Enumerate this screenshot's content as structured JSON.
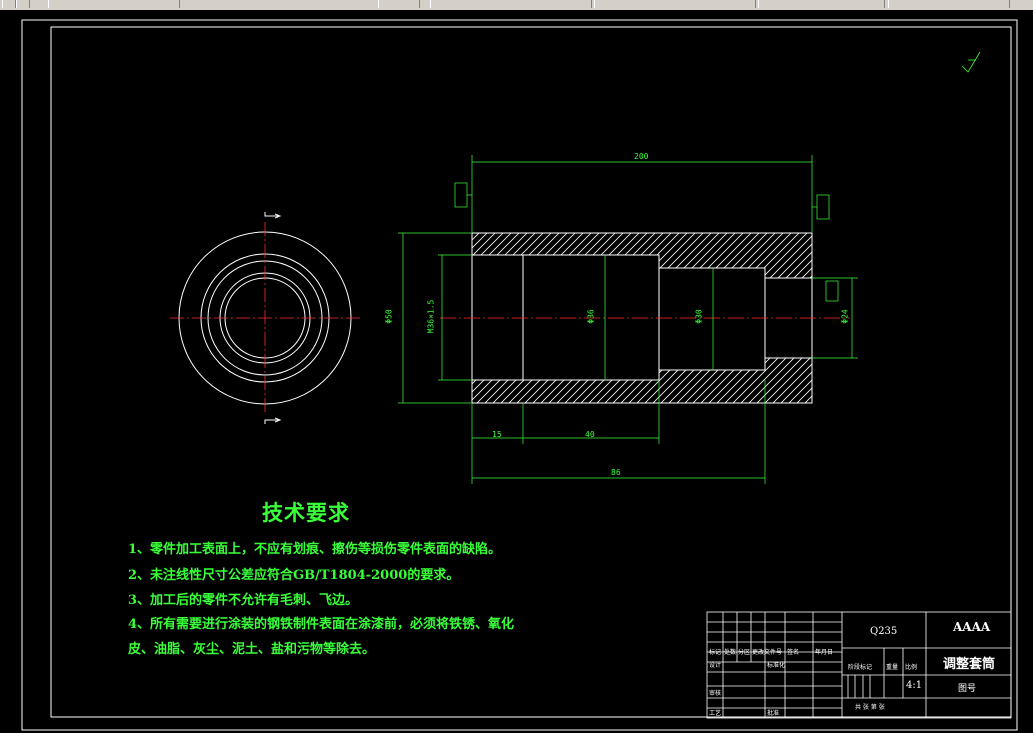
{
  "dimensions": {
    "overall_length": "200",
    "bottom_total": "86",
    "seg_15": "15",
    "seg_40": "40",
    "phi_outer": "Φ50",
    "thread": "M36×1.5",
    "phi_mid": "Φ36",
    "phi_step": "Φ30",
    "phi_right": "Φ24"
  },
  "tech_requirements": {
    "title": "技术要求",
    "items": [
      "1、零件加工表面上，不应有划痕、擦伤等损伤零件表面的缺陷。",
      "2、未注线性尺寸公差应符合GB/T1804-2000的要求。",
      "3、加工后的零件不允许有毛刺、飞边。",
      "4、所有需要进行涂装的钢铁制件表面在涂漆前，必须将铁锈、氧化",
      "皮、油脂、灰尘、泥土、盐和污物等除去。"
    ]
  },
  "title_block": {
    "material": "Q235",
    "company": "AAAA",
    "part_name": "调整套筒",
    "scale": "4:1",
    "drawing_no_label": "图号",
    "design_label": "设计",
    "review_label": "审核",
    "process_label": "工艺",
    "standard_label": "标准化",
    "approve_label": "批准",
    "stage_label": "阶段标记",
    "weight_label": "重量",
    "scale_label": "比例",
    "sheet_label": "共  张  第  张",
    "rev_headers": [
      "标记",
      "处数",
      "分区",
      "更改文件号",
      "签名",
      "年月日"
    ]
  },
  "colors": {
    "outline": "#ffffff",
    "dimension": "#39ff39",
    "centerline": "#ff2a2a",
    "background": "#000000"
  }
}
